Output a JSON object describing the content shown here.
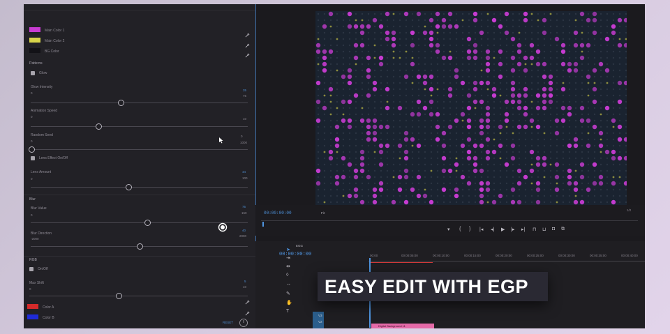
{
  "colors": {
    "pink": "#c83cd2",
    "yellow": "#d8d44a",
    "bg_dark": "#131217",
    "red": "#d42a2a",
    "blue": "#1f2bd8",
    "timecode": "#4f95e0",
    "clip_pink": "#e56aa8"
  },
  "effect_controls": {
    "color_rows": [
      {
        "label": "Main Color 1",
        "swatch": "#c83cd2"
      },
      {
        "label": "Main Color 2",
        "swatch": "#d8d44a"
      },
      {
        "label": "BG Color",
        "swatch": "#131217"
      }
    ],
    "pattern_section": "Patterns",
    "glow_label": "Glow",
    "glow_intensity": {
      "label": "Glow Intensity",
      "value": "35",
      "min": "0",
      "max": "75",
      "fraction": 0.55
    },
    "animation_speed": {
      "label": "Animation Speed",
      "value": "",
      "min": "0",
      "max": "10",
      "fraction": 0.33
    },
    "random_seed": {
      "label": "Random Seed",
      "value": "0",
      "min": "0",
      "max": "1000",
      "fraction": 0.0
    },
    "lens_effect": "Lens Effect On/Off",
    "lens_amount": {
      "label": "Lens Amount",
      "value": "44",
      "min": "0",
      "max": "100",
      "fraction": 0.44
    },
    "blur_section": "Blur",
    "blur_value": {
      "label": "Blur Value",
      "value": "75",
      "min": "0",
      "max": "150",
      "fraction": 0.5
    },
    "blur_direction": {
      "label": "Blur Direction",
      "value": "40",
      "min": "-2000",
      "max": "2000",
      "fraction": 0.5
    },
    "rgb_section": "RGB",
    "rgb_onoff": "On/Off",
    "max_shift": {
      "label": "Max Shift",
      "value": "5",
      "min": "0",
      "max": "10",
      "fraction": 0.4
    },
    "color_a": {
      "label": "Color A",
      "swatch": "#d42a2a"
    },
    "color_b": {
      "label": "Color B",
      "swatch": "#1f2bd8"
    },
    "reset_label": "RESET"
  },
  "program_monitor": {
    "timecode": "00:00:00:00",
    "fit": "Fit",
    "page": "1/2"
  },
  "timeline": {
    "sequence_name": "EGG",
    "timecode": "00:00:00:00",
    "ruler": [
      "00:00",
      "00:00:05:00",
      "00:00:10:00",
      "00:00:15:00",
      "00:00:20:00",
      "00:00:25:00",
      "00:00:30:00",
      "00:00:35:00",
      "00:00:40:00",
      "00:00:45:00"
    ],
    "tracks": [
      "V3",
      "V2",
      "V1"
    ],
    "clip_label": "Digital Background 11"
  },
  "banner": "EASY EDIT WITH EGP"
}
